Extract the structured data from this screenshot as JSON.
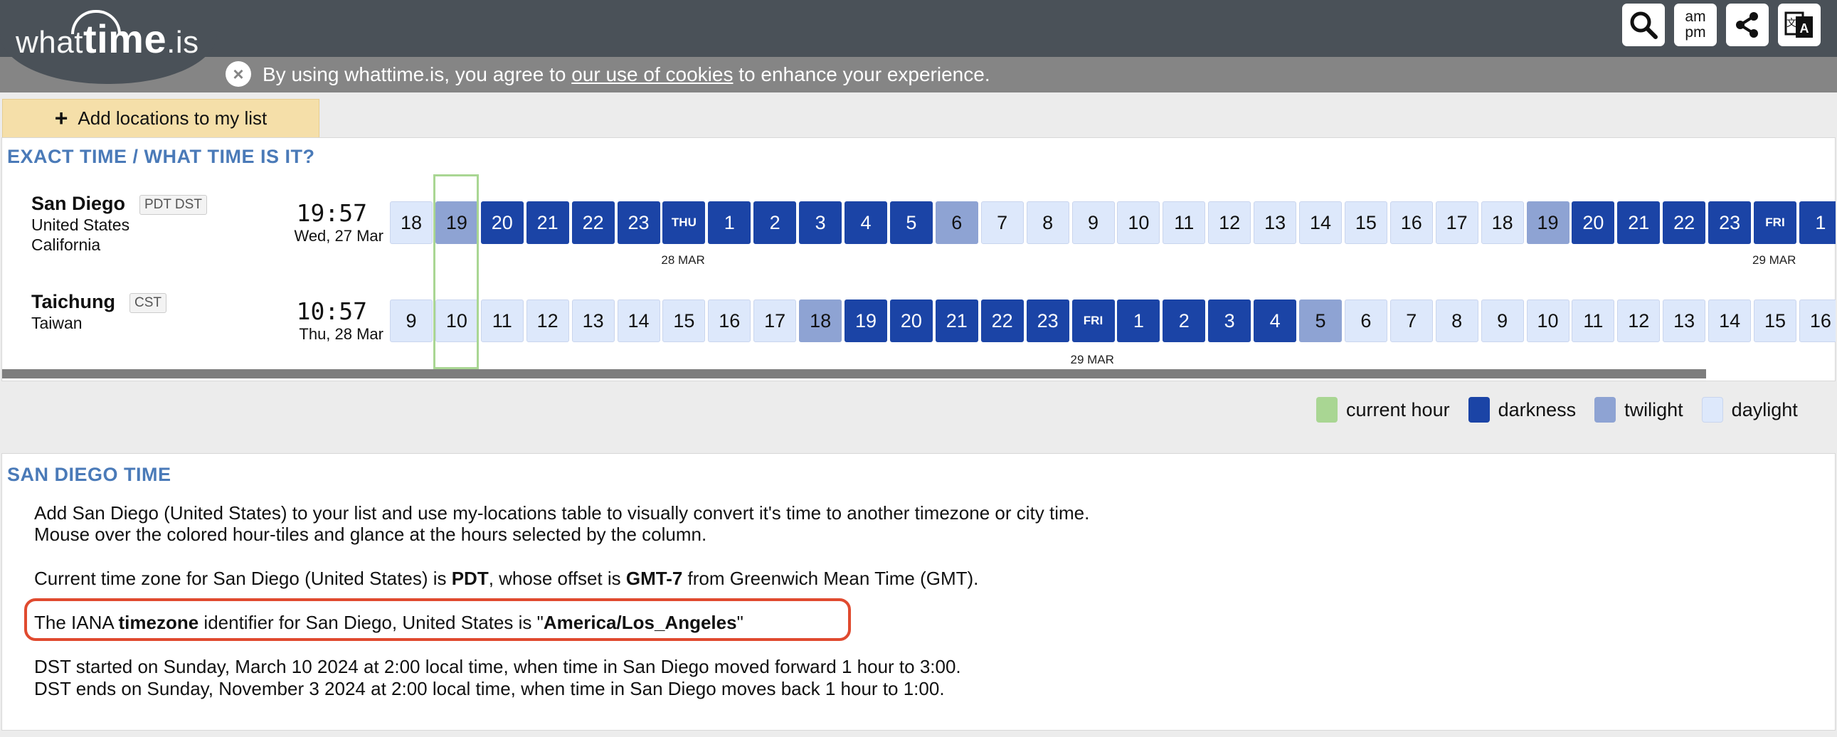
{
  "logo": {
    "what": "what",
    "time": "time",
    "is": ".is"
  },
  "toolbar": {
    "search_icon": "search-icon",
    "ampm_top": "am",
    "ampm_bottom": "pm",
    "share_icon": "share-icon",
    "translate_icon": "translate-icon"
  },
  "cookie": {
    "before": "By using whattime.is, you agree to ",
    "link": "our use of cookies",
    "after": " to enhance your experience."
  },
  "add_tab": {
    "label": "Add locations to my list"
  },
  "exact_panel": {
    "title": "EXACT TIME / WHAT TIME IS IT?"
  },
  "locations": [
    {
      "name": "San Diego",
      "badge": "PDT DST",
      "country": "United States",
      "region": "California",
      "time": "19:57",
      "date": "Wed, 27 Mar",
      "tiles": [
        {
          "l": "18",
          "t": "day"
        },
        {
          "l": "19",
          "t": "twi"
        },
        {
          "l": "20",
          "t": "dark"
        },
        {
          "l": "21",
          "t": "dark"
        },
        {
          "l": "22",
          "t": "dark"
        },
        {
          "l": "23",
          "t": "dark"
        },
        {
          "l": "THU",
          "t": "dark",
          "dn": true
        },
        {
          "l": "1",
          "t": "dark"
        },
        {
          "l": "2",
          "t": "dark"
        },
        {
          "l": "3",
          "t": "dark"
        },
        {
          "l": "4",
          "t": "dark"
        },
        {
          "l": "5",
          "t": "dark"
        },
        {
          "l": "6",
          "t": "twi"
        },
        {
          "l": "7",
          "t": "day"
        },
        {
          "l": "8",
          "t": "day"
        },
        {
          "l": "9",
          "t": "day"
        },
        {
          "l": "10",
          "t": "day"
        },
        {
          "l": "11",
          "t": "day"
        },
        {
          "l": "12",
          "t": "day"
        },
        {
          "l": "13",
          "t": "day"
        },
        {
          "l": "14",
          "t": "day"
        },
        {
          "l": "15",
          "t": "day"
        },
        {
          "l": "16",
          "t": "day"
        },
        {
          "l": "17",
          "t": "day"
        },
        {
          "l": "18",
          "t": "day"
        },
        {
          "l": "19",
          "t": "twi"
        },
        {
          "l": "20",
          "t": "dark"
        },
        {
          "l": "21",
          "t": "dark"
        },
        {
          "l": "22",
          "t": "dark"
        },
        {
          "l": "23",
          "t": "dark"
        },
        {
          "l": "FRI",
          "t": "dark",
          "dn": true
        },
        {
          "l": "1",
          "t": "dark"
        }
      ],
      "date_labels": [
        {
          "text": "28 MAR",
          "col": 6
        },
        {
          "text": "29 MAR",
          "col": 30
        }
      ]
    },
    {
      "name": "Taichung",
      "badge": "CST",
      "country": "Taiwan",
      "region": "",
      "time": "10:57",
      "date": "Thu, 28 Mar",
      "tiles": [
        {
          "l": "9",
          "t": "day"
        },
        {
          "l": "10",
          "t": "day"
        },
        {
          "l": "11",
          "t": "day"
        },
        {
          "l": "12",
          "t": "day"
        },
        {
          "l": "13",
          "t": "day"
        },
        {
          "l": "14",
          "t": "day"
        },
        {
          "l": "15",
          "t": "day"
        },
        {
          "l": "16",
          "t": "day"
        },
        {
          "l": "17",
          "t": "day"
        },
        {
          "l": "18",
          "t": "twi"
        },
        {
          "l": "19",
          "t": "dark"
        },
        {
          "l": "20",
          "t": "dark"
        },
        {
          "l": "21",
          "t": "dark"
        },
        {
          "l": "22",
          "t": "dark"
        },
        {
          "l": "23",
          "t": "dark"
        },
        {
          "l": "FRI",
          "t": "dark",
          "dn": true
        },
        {
          "l": "1",
          "t": "dark"
        },
        {
          "l": "2",
          "t": "dark"
        },
        {
          "l": "3",
          "t": "dark"
        },
        {
          "l": "4",
          "t": "dark"
        },
        {
          "l": "5",
          "t": "twi"
        },
        {
          "l": "6",
          "t": "day"
        },
        {
          "l": "7",
          "t": "day"
        },
        {
          "l": "8",
          "t": "day"
        },
        {
          "l": "9",
          "t": "day"
        },
        {
          "l": "10",
          "t": "day"
        },
        {
          "l": "11",
          "t": "day"
        },
        {
          "l": "12",
          "t": "day"
        },
        {
          "l": "13",
          "t": "day"
        },
        {
          "l": "14",
          "t": "day"
        },
        {
          "l": "15",
          "t": "day"
        },
        {
          "l": "16",
          "t": "day"
        }
      ],
      "date_labels": [
        {
          "text": "29 MAR",
          "col": 15
        }
      ]
    }
  ],
  "legend": {
    "current": "current hour",
    "darkness": "darkness",
    "twilight": "twilight",
    "daylight": "daylight"
  },
  "colors": {
    "current": "#a9d693",
    "darkness": "#1b44a6",
    "twilight": "#8ea3d3",
    "daylight": "#dde8fb",
    "accent": "#4a7ab8",
    "highlight": "#e04a2f"
  },
  "sd_panel": {
    "title": "SAN DIEGO TIME",
    "p1": "Add San Diego (United States) to your list and use my-locations table to visually convert it's time to another timezone or city time.",
    "p2": "Mouse over the colored hour-tiles and glance at the hours selected by the column.",
    "p3_a": "Current time zone for San Diego (United States) is ",
    "p3_b": "PDT",
    "p3_c": ", whose offset is ",
    "p3_d": "GMT-7",
    "p3_e": " from Greenwich Mean Time (GMT).",
    "p4_a": "The IANA ",
    "p4_b": "timezone",
    "p4_c": " identifier for San Diego, United States is \"",
    "p4_d": "America/Los_Angeles",
    "p4_e": "\"",
    "p5": "DST started on Sunday, March 10 2024 at 2:00 local time, when time in San Diego moved forward 1 hour to 3:00.",
    "p6": "DST ends on Sunday, November 3 2024 at 2:00 local time, when time in San Diego moves back 1 hour to 1:00."
  }
}
